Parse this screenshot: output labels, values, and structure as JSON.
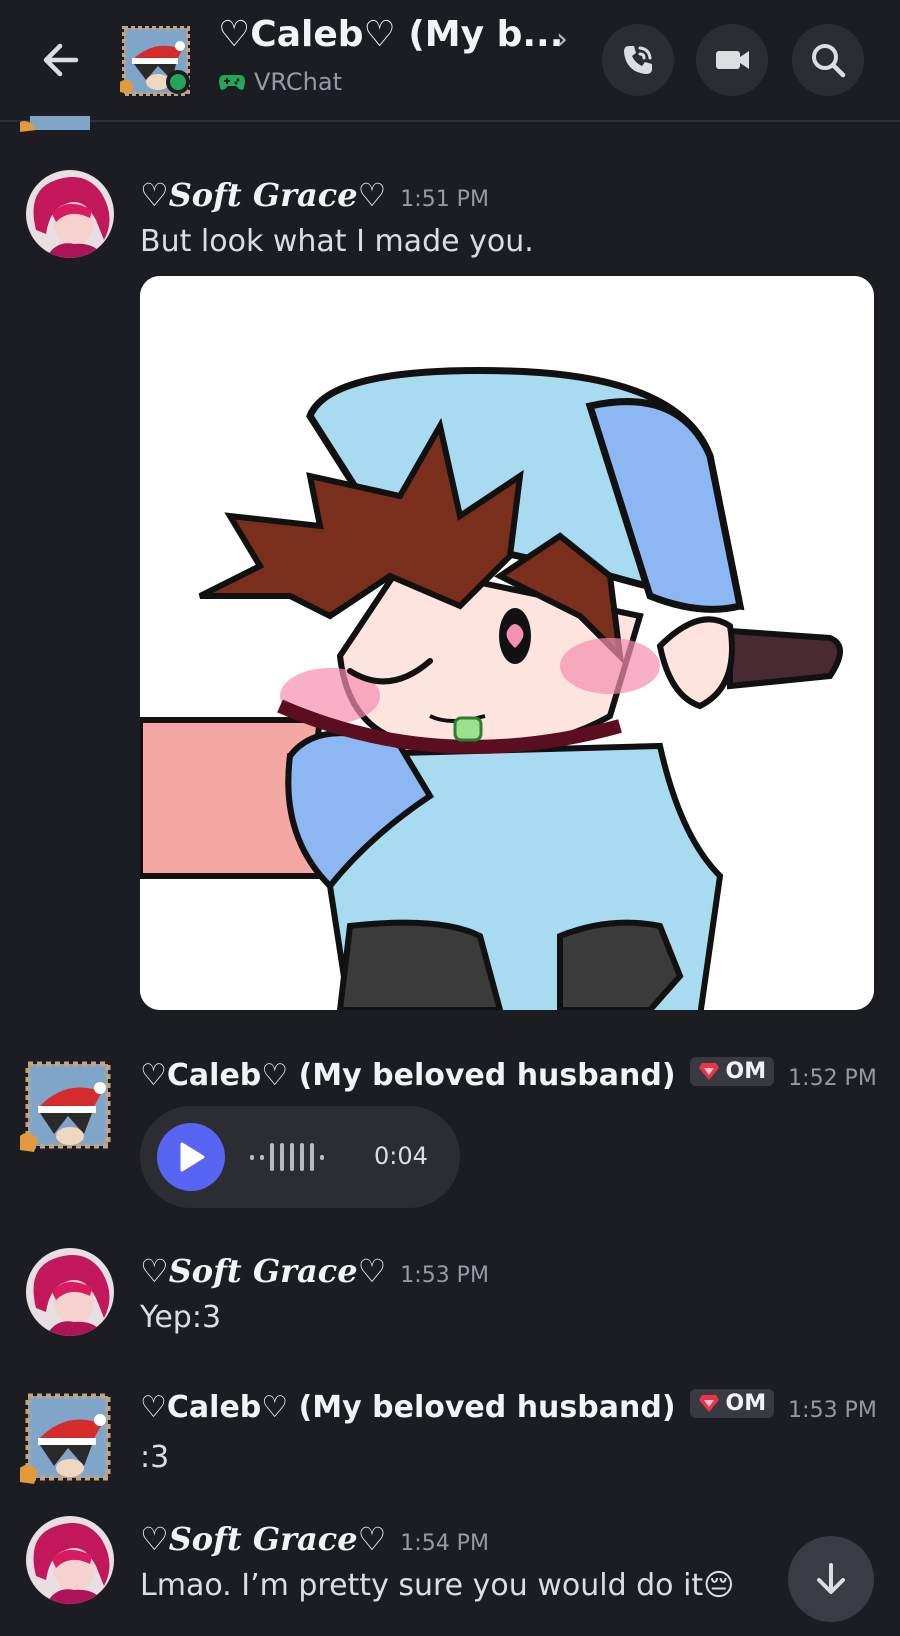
{
  "header": {
    "title": "♡Caleb♡ (My b...",
    "chevron": "›",
    "activity": "VRChat",
    "icons": {
      "back": "arrow-left-icon",
      "call": "phone-call-icon",
      "video": "video-camera-icon",
      "search": "search-icon",
      "game": "gamepad-icon"
    }
  },
  "messages": [
    {
      "author": "♡𝑺𝒐𝒇𝒕 𝑮𝒓𝒂𝒄𝒆♡",
      "time": "1:51 PM",
      "text": "But look what I made you."
    },
    {
      "author": "♡Caleb♡ (My beloved husband)",
      "tag": "OM",
      "time": "1:52 PM",
      "voice_duration": "0:04"
    },
    {
      "author": "♡𝑺𝒐𝒇𝒕 𝑮𝒓𝒂𝒄𝒆♡",
      "time": "1:53 PM",
      "text": "Yep:3"
    },
    {
      "author": "♡Caleb♡ (My beloved husband)",
      "tag": "OM",
      "time": "1:53 PM",
      "text": ":3"
    },
    {
      "author": "♡𝑺𝒐𝒇𝒕 𝑮𝒓𝒂𝒄𝒆♡",
      "time": "1:54 PM",
      "text": "Lmao. I’m pretty sure you would do it😔"
    }
  ],
  "colors": {
    "background": "#1c1d22",
    "accent": "#5865f2",
    "online": "#23a55a",
    "tag_gem": "#e8334a"
  }
}
